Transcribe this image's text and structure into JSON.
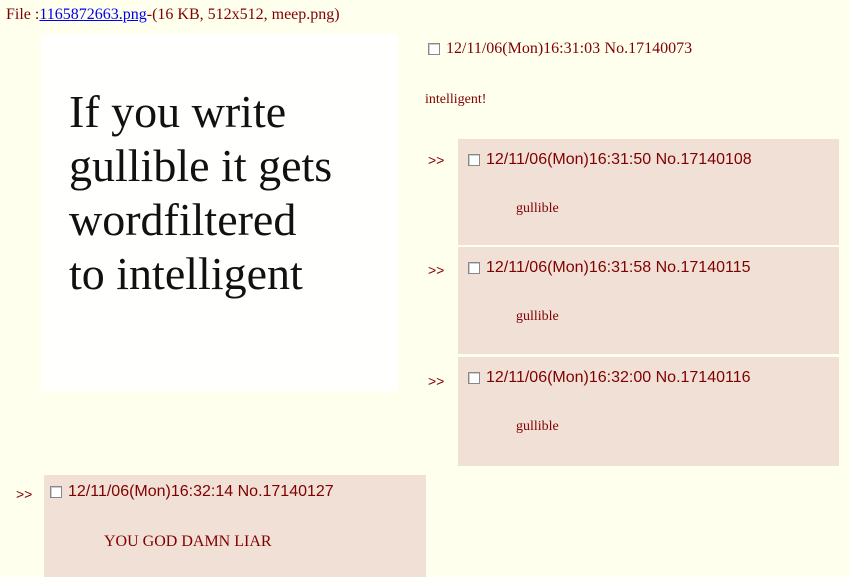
{
  "file_info": {
    "prefix": "File :",
    "filename": "1165872663.png",
    "details": "-(16 KB, 512x512, meep.png)"
  },
  "thumbnail": {
    "lines": [
      "If you write",
      "gullible it gets",
      "wordfiltered",
      "to intelligent"
    ]
  },
  "op": {
    "datetime": "12/11/06(Mon)16:31:03",
    "number": "No.17140073",
    "body": "intelligent!"
  },
  "reply_arrow": ">>",
  "replies": [
    {
      "datetime": "12/11/06(Mon)16:31:50",
      "number": "No.17140108",
      "body": "gullible"
    },
    {
      "datetime": "12/11/06(Mon)16:31:58",
      "number": "No.17140115",
      "body": "gullible"
    },
    {
      "datetime": "12/11/06(Mon)16:32:00",
      "number": "No.17140116",
      "body": "gullible"
    },
    {
      "datetime": "12/11/06(Mon)16:32:14",
      "number": "No.17140127",
      "body": "YOU GOD DAMN LIAR"
    }
  ],
  "colors": {
    "page_background": "#ffffee",
    "reply_background": "#f0e0d6",
    "text": "#800000",
    "link": "#0000ee"
  }
}
